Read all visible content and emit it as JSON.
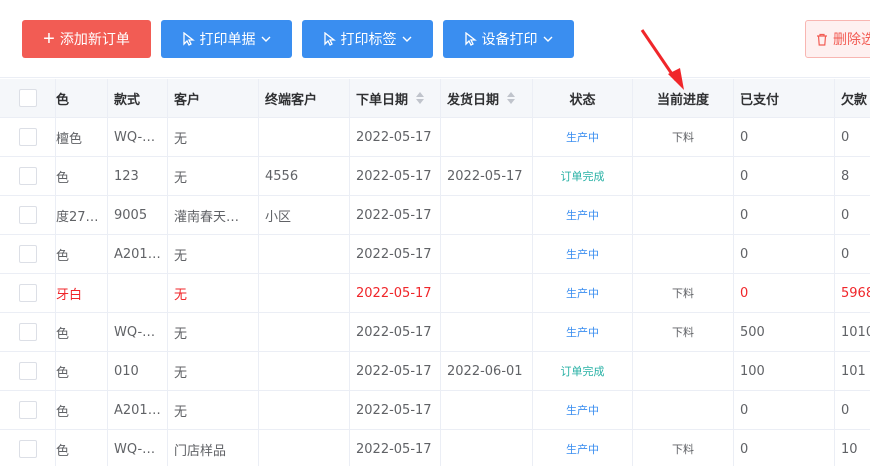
{
  "toolbar": {
    "add_label": "添加新订单",
    "print_doc_label": "打印单据",
    "print_label_label": "打印标签",
    "device_print_label": "设备打印",
    "delete_label": "删除选"
  },
  "table": {
    "headers": {
      "color": "色",
      "style": "款式",
      "customer": "客户",
      "end_customer": "终端客户",
      "order_date": "下单日期",
      "ship_date": "发货日期",
      "status": "状态",
      "progress": "当前进度",
      "paid": "已支付",
      "owed": "欠款"
    },
    "rows": [
      {
        "color": "檀色",
        "style": "WQ-…",
        "customer": "无",
        "end_customer": "",
        "order_date": "2022-05-17",
        "ship_date": "",
        "status": "生产中",
        "progress": "下料",
        "paid": "0",
        "owed": "0"
      },
      {
        "color": "色",
        "style": "123",
        "customer": "无",
        "end_customer": "4556",
        "order_date": "2022-05-17",
        "ship_date": "2022-05-17",
        "status": "订单完成",
        "progress": "",
        "paid": "0",
        "owed": "8"
      },
      {
        "color": "度27…",
        "style": "9005",
        "customer": "灌南春天…",
        "end_customer": "小区",
        "order_date": "2022-05-17",
        "ship_date": "",
        "status": "生产中",
        "progress": "",
        "paid": "0",
        "owed": "0"
      },
      {
        "color": "色",
        "style": "A201…",
        "customer": "无",
        "end_customer": "",
        "order_date": "2022-05-17",
        "ship_date": "",
        "status": "生产中",
        "progress": "",
        "paid": "0",
        "owed": "0"
      },
      {
        "color": "牙白",
        "style": "",
        "customer": "无",
        "end_customer": "",
        "order_date": "2022-05-17",
        "ship_date": "",
        "status": "生产中",
        "progress": "下料",
        "paid": "0",
        "owed": "5968"
      },
      {
        "color": "色",
        "style": "WQ-…",
        "customer": "无",
        "end_customer": "",
        "order_date": "2022-05-17",
        "ship_date": "",
        "status": "生产中",
        "progress": "下料",
        "paid": "500",
        "owed": "1010"
      },
      {
        "color": "色",
        "style": "010",
        "customer": "无",
        "end_customer": "",
        "order_date": "2022-05-17",
        "ship_date": "2022-06-01",
        "status": "订单完成",
        "progress": "",
        "paid": "100",
        "owed": "101"
      },
      {
        "color": "色",
        "style": "A201…",
        "customer": "无",
        "end_customer": "",
        "order_date": "2022-05-17",
        "ship_date": "",
        "status": "生产中",
        "progress": "",
        "paid": "0",
        "owed": "0"
      },
      {
        "color": "色",
        "style": "WQ-…",
        "customer": "门店样品",
        "end_customer": "",
        "order_date": "2022-05-17",
        "ship_date": "",
        "status": "生产中",
        "progress": "下料",
        "paid": "0",
        "owed": "10"
      }
    ]
  },
  "colors": {
    "add_button": "#f25c54",
    "primary_button": "#3a8ef0",
    "status_in_production": "#3a8ef0",
    "status_completed": "#28b1a5",
    "highlight_row_text": "#f0262a",
    "annotation_arrow": "#f0262a"
  }
}
